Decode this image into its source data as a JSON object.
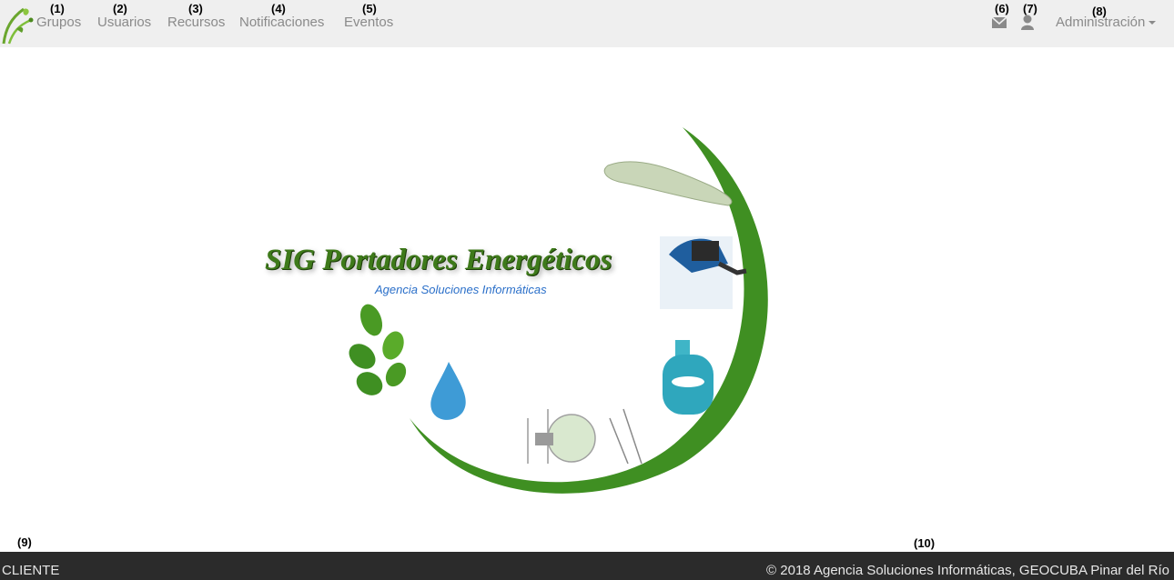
{
  "markers": [
    "(1)",
    "(2)",
    "(3)",
    "(4)",
    "(5)",
    "(6)",
    "(7)",
    "(8)",
    "(9)",
    "(10)"
  ],
  "nav": {
    "items": [
      {
        "label": "Grupos"
      },
      {
        "label": "Usuarios"
      },
      {
        "label": "Recursos"
      },
      {
        "label": "Notificaciones"
      },
      {
        "label": "Eventos"
      }
    ],
    "mail_icon": "envelope-icon",
    "user_icon": "user-icon",
    "admin_label": "Administración"
  },
  "hero": {
    "title": "SIG Portadores Energéticos",
    "subtitle": "Agencia Soluciones Informáticas",
    "colors": {
      "ring": "#3f8f22",
      "title": "#3e7a1a",
      "subtitle": "#2a6fc9"
    }
  },
  "footer": {
    "left": "CLIENTE",
    "right": "© 2018 Agencia Soluciones Informáticas, GEOCUBA Pinar del Río"
  }
}
